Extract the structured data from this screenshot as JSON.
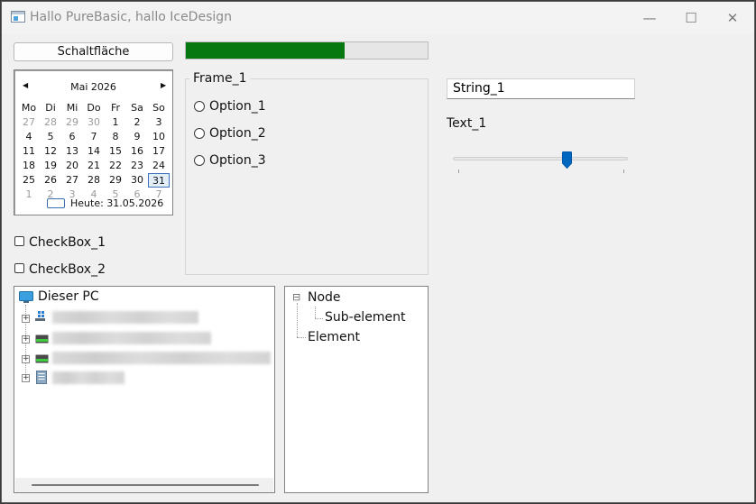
{
  "window": {
    "title": "Hallo PureBasic, hallo IceDesign"
  },
  "titlebar": {
    "minimize": "—",
    "maximize": "☐",
    "close": "✕"
  },
  "button": {
    "label": "Schaltfläche"
  },
  "progress": {
    "value": 0.655,
    "color": "#06780f"
  },
  "calendar": {
    "month_label": "Mai 2026",
    "weekdays": [
      "Mo",
      "Di",
      "Mi",
      "Do",
      "Fr",
      "Sa",
      "So"
    ],
    "weeks": [
      [
        "27",
        "28",
        "29",
        "30",
        "1",
        "2",
        "3"
      ],
      [
        "4",
        "5",
        "6",
        "7",
        "8",
        "9",
        "10"
      ],
      [
        "11",
        "12",
        "13",
        "14",
        "15",
        "16",
        "17"
      ],
      [
        "18",
        "19",
        "20",
        "21",
        "22",
        "23",
        "24"
      ],
      [
        "25",
        "26",
        "27",
        "28",
        "29",
        "30",
        "31"
      ],
      [
        "1",
        "2",
        "3",
        "4",
        "5",
        "6",
        "7"
      ]
    ],
    "selected": "31",
    "today_label": "Heute: 31.05.2026"
  },
  "checkboxes": [
    "CheckBox_1",
    "CheckBox_2"
  ],
  "frame": {
    "title": "Frame_1",
    "options": [
      "Option_1",
      "Option_2",
      "Option_3"
    ]
  },
  "string_gadget": {
    "value": "String_1"
  },
  "text_gadget": {
    "label": "Text_1"
  },
  "trackbar": {
    "value": 0.65,
    "accent": "#0067c0"
  },
  "explorer": {
    "root_label": "Dieser PC",
    "icons": [
      "computer-icon",
      "windows-drive-icon",
      "drive-icon",
      "drive-icon",
      "document-icon"
    ]
  },
  "tree": {
    "node_label": "Node",
    "sub_label": "Sub-element",
    "element_label": "Element",
    "collapse_glyph": "⊟"
  }
}
